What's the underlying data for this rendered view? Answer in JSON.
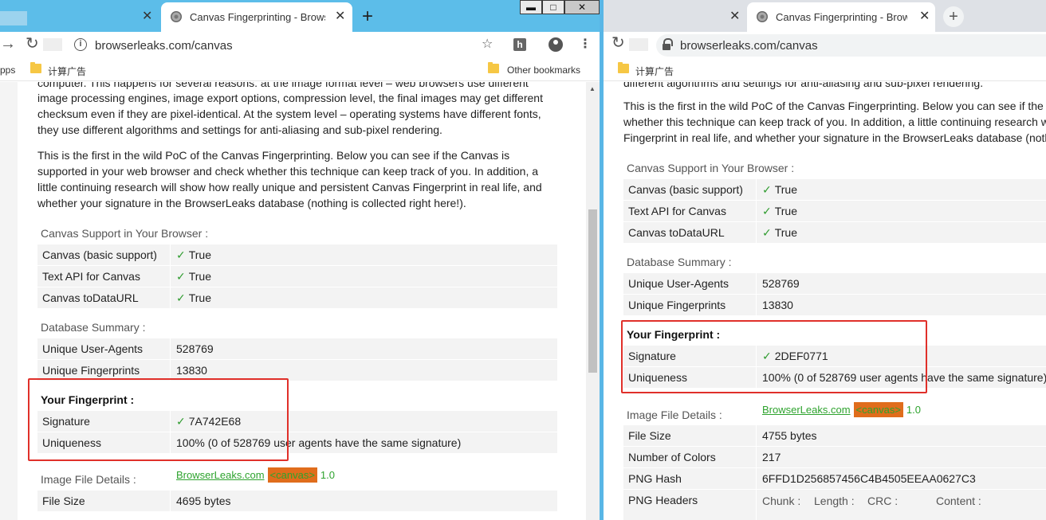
{
  "left": {
    "tabs": [
      {
        "title": "",
        "close": "✕"
      },
      {
        "title": "Canvas Fingerprinting - Browse",
        "close": "✕"
      }
    ],
    "new_tab": "+",
    "window_controls": {
      "minimize": "▬",
      "maximize": "□",
      "close": "✕"
    },
    "url": "browserleaks.com/canvas",
    "secure_icon": "i",
    "ext_h": "h",
    "bookmarks": [
      {
        "label": "pps"
      },
      {
        "label": "计算广告"
      },
      {
        "label": "Other bookmarks"
      }
    ],
    "paragraphs": [
      "computer. This happens for several reasons: at the image format level – web browsers use different",
      "image processing engines, image export options, compression level, the final images may get different",
      "checksum even if they are pixel-identical. At the system level – operating systems have different fonts,",
      "they use different algorithms and settings for anti-aliasing and sub-pixel rendering.",
      "This is the first in the wild PoC of the Canvas Fingerprinting. Below you can see if the Canvas is",
      "supported in your web browser and check whether this technique can keep track of you. In addition, a",
      "little continuing research will show how really unique and persistent Canvas Fingerprint in real life, and",
      "whether your signature in the BrowserLeaks database (nothing is collected right here!)."
    ],
    "support_label": "Canvas Support in Your Browser :",
    "support_rows": [
      {
        "key": "Canvas (basic support)",
        "check": "✓",
        "value": "True"
      },
      {
        "key": "Text API for Canvas",
        "check": "✓",
        "value": "True"
      },
      {
        "key": "Canvas toDataURL",
        "check": "✓",
        "value": "True"
      }
    ],
    "db_label": "Database Summary :",
    "db_rows": [
      {
        "key": "Unique User-Agents",
        "value": "528769"
      },
      {
        "key": "Unique Fingerprints",
        "value": "13830"
      }
    ],
    "fp_label": "Your Fingerprint :",
    "fp_rows": [
      {
        "key": "Signature",
        "check": "✓",
        "value": "7A742E68"
      },
      {
        "key": "Uniqueness",
        "value": "100% (0 of 528769 user agents have the same signature)"
      }
    ],
    "image_label": "Image File Details :",
    "logo": {
      "site": "BrowserLeaks.com",
      "tag": "<canvas>",
      "ver": "1.0"
    },
    "image_rows": [
      {
        "key": "File Size",
        "value": "4695 bytes"
      }
    ]
  },
  "right": {
    "tabs": [
      {
        "title": "",
        "close": "✕"
      },
      {
        "title": "Canvas Fingerprinting - Browse",
        "close": "✕"
      }
    ],
    "new_tab": "+",
    "url": "browserleaks.com/canvas",
    "bookmarks": [
      {
        "label": "计算广告"
      }
    ],
    "paragraphs": [
      "different algorithms and settings for anti-aliasing and sub-pixel rendering.",
      "This is the first in the wild PoC of the Canvas Fingerprinting. Below you can see if the",
      "whether this technique can keep track of you. In addition, a little continuing research w",
      "Fingerprint in real life, and whether your signature in the BrowserLeaks database (noth"
    ],
    "support_label": "Canvas Support in Your Browser :",
    "support_rows": [
      {
        "key": "Canvas (basic support)",
        "check": "✓",
        "value": "True"
      },
      {
        "key": "Text API for Canvas",
        "check": "✓",
        "value": "True"
      },
      {
        "key": "Canvas toDataURL",
        "check": "✓",
        "value": "True"
      }
    ],
    "db_label": "Database Summary :",
    "db_rows": [
      {
        "key": "Unique User-Agents",
        "value": "528769"
      },
      {
        "key": "Unique Fingerprints",
        "value": "13830"
      }
    ],
    "fp_label": "Your Fingerprint :",
    "fp_rows": [
      {
        "key": "Signature",
        "check": "✓",
        "value": "2DEF0771"
      },
      {
        "key": "Uniqueness",
        "value": "100% (0 of 528769 user agents have the same signature)"
      }
    ],
    "image_label": "Image File Details :",
    "logo": {
      "site": "BrowserLeaks.com",
      "tag": "<canvas>",
      "ver": "1.0"
    },
    "image_rows": [
      {
        "key": "File Size",
        "value": "4755 bytes"
      },
      {
        "key": "Number of Colors",
        "value": "217"
      },
      {
        "key": "PNG Hash",
        "value": "6FFD1D256857456C4B4505EEAA0627C3"
      },
      {
        "key": "PNG Headers",
        "value": ""
      }
    ],
    "png_header_cols": [
      "Chunk :",
      "Length :",
      "CRC :",
      "Content :"
    ]
  },
  "colors": {
    "left_tabstrip": "#5cbde9",
    "right_tabstrip": "#dee1e6",
    "check": "#2e9b2e",
    "highlight": "#e0302a",
    "canvas_tag": "#e06d1c"
  }
}
